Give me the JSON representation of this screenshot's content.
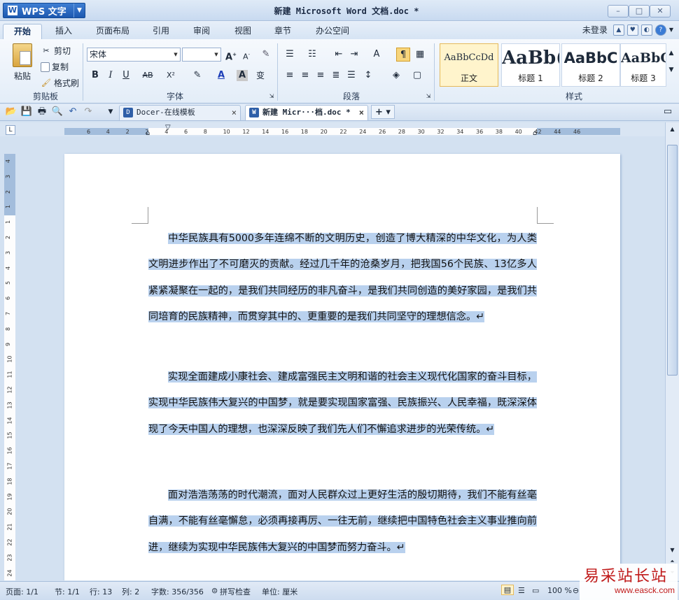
{
  "app": {
    "name": "WPS 文字",
    "doc_title": "新建 Microsoft Word 文档.doc *"
  },
  "menu": {
    "tabs": [
      "开始",
      "插入",
      "页面布局",
      "引用",
      "审阅",
      "视图",
      "章节",
      "办公空间"
    ],
    "login": "未登录"
  },
  "ribbon": {
    "paste": "粘贴",
    "cut": "剪切",
    "copy": "复制",
    "format_painter": "格式刷",
    "group_clipboard": "剪贴板",
    "group_font": "字体",
    "group_paragraph": "段落",
    "group_styles": "样式",
    "font_name": "宋体",
    "font_size": "",
    "bold": "B",
    "italic": "I",
    "underline": "U",
    "strike": "AB",
    "superscript": "X²",
    "text_color": "A",
    "char_shading": "A",
    "phonetic": "变",
    "styles": [
      {
        "sample": "AaBbCcDd",
        "name": "正文"
      },
      {
        "sample": "AaBb(",
        "name": "标题 1"
      },
      {
        "sample": "AaBbC",
        "name": "标题 2"
      },
      {
        "sample": "AaBbC",
        "name": "标题 3"
      }
    ]
  },
  "doc_tabs": [
    {
      "label": "Docer-在线模板",
      "close": "×"
    },
    {
      "label": "新建 Micr···档.doc *",
      "close": "×"
    }
  ],
  "ruler_h": [
    "6",
    "4",
    "2",
    "2",
    "4",
    "6",
    "8",
    "10",
    "12",
    "14",
    "16",
    "18",
    "20",
    "22",
    "24",
    "26",
    "28",
    "30",
    "32",
    "34",
    "36",
    "38",
    "40",
    "42",
    "44",
    "46"
  ],
  "ruler_v": [
    "4",
    "3",
    "2",
    "1",
    "1",
    "2",
    "3",
    "4",
    "5",
    "6",
    "7",
    "8",
    "9",
    "10",
    "11",
    "12",
    "13",
    "14",
    "15",
    "16",
    "17",
    "18",
    "19",
    "20",
    "21",
    "22",
    "23",
    "24"
  ],
  "document": {
    "paragraphs": [
      "中华民族具有5000多年连绵不断的文明历史，创造了博大精深的中华文化，为人类文明进步作出了不可磨灭的贡献。经过几千年的沧桑岁月，把我国56个民族、13亿多人紧紧凝聚在一起的，是我们共同经历的非凡奋斗，是我们共同创造的美好家园，是我们共同培育的民族精神，而贯穿其中的、更重要的是我们共同坚守的理想信念。↵",
      "实现全面建成小康社会、建成富强民主文明和谐的社会主义现代化国家的奋斗目标，实现中华民族伟大复兴的中国梦，就是要实现国家富强、民族振兴、人民幸福，既深深体现了今天中国人的理想，也深深反映了我们先人们不懈追求进步的光荣传统。↵",
      "面对浩浩荡荡的时代潮流，面对人民群众过上更好生活的殷切期待，我们不能有丝毫自满，不能有丝毫懈怠，必须再接再厉、一往无前，继续把中国特色社会主义事业推向前进，继续为实现中华民族伟大复兴的中国梦而努力奋斗。↵"
    ]
  },
  "status": {
    "page": "页面: 1/1",
    "section": "节: 1/1",
    "row": "行: 13",
    "col": "列: 2",
    "words": "字数: 356/356",
    "spell": "拼写检查",
    "unit": "单位: 厘米",
    "zoom": "100 %"
  },
  "watermark": {
    "text": "易采站长站",
    "url": "www.easck.com"
  },
  "colors": {
    "selection": "#b9d1ee",
    "accent": "#1c58b0"
  }
}
